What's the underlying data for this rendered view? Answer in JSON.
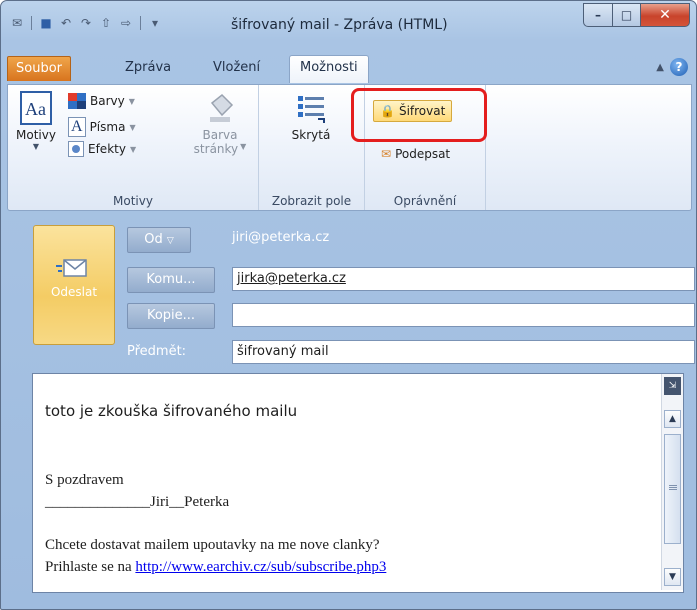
{
  "window": {
    "title": "šifrovaný mail - Zpráva (HTML)",
    "minimize_glyph": "–",
    "maximize_glyph": "□",
    "close_glyph": "✕"
  },
  "tabs": [
    {
      "label": "Soubor"
    },
    {
      "label": "Zpráva"
    },
    {
      "label": "Vložení"
    },
    {
      "label": "Možnosti"
    }
  ],
  "ribbon": {
    "motivy_group": {
      "motivy_label": "Motivy",
      "barvy_label": "Barvy",
      "pisma_label": "Písma",
      "efekty_label": "Efekty",
      "barva_label_line1": "Barva",
      "barva_label_line2": "stránky",
      "group_label": "Motivy"
    },
    "zobrazit_group": {
      "skryta_label": "Skrytá",
      "group_label": "Zobrazit pole"
    },
    "opravneni_group": {
      "sifrovat_label": "Šifrovat",
      "podepsat_label": "Podepsat",
      "group_label": "Oprávnění"
    }
  },
  "compose": {
    "send_label": "Odeslat",
    "from_button": "Od",
    "from_value": "jiri@peterka.cz",
    "to_button": "Komu...",
    "to_value": "jirka@peterka.cz",
    "cc_button": "Kopie...",
    "cc_value": "",
    "subject_label": "Předmět:",
    "subject_value": "šifrovaný mail"
  },
  "body": {
    "line1": "toto je zkouška šifrovaného mailu",
    "greeting": "S pozdravem",
    "signature": "______________Jiri__Peterka",
    "promo_line1": "Chcete dostavat mailem upoutavky na me nove clanky?",
    "promo_line2_prefix": "Prihlaste se na ",
    "promo_link": "http://www.earchiv.cz/sub/subscribe.php3"
  },
  "colors": {
    "accent_highlight": "#e41e1e",
    "file_tab": "#e88a2e",
    "send_button": "#f4cc64"
  }
}
